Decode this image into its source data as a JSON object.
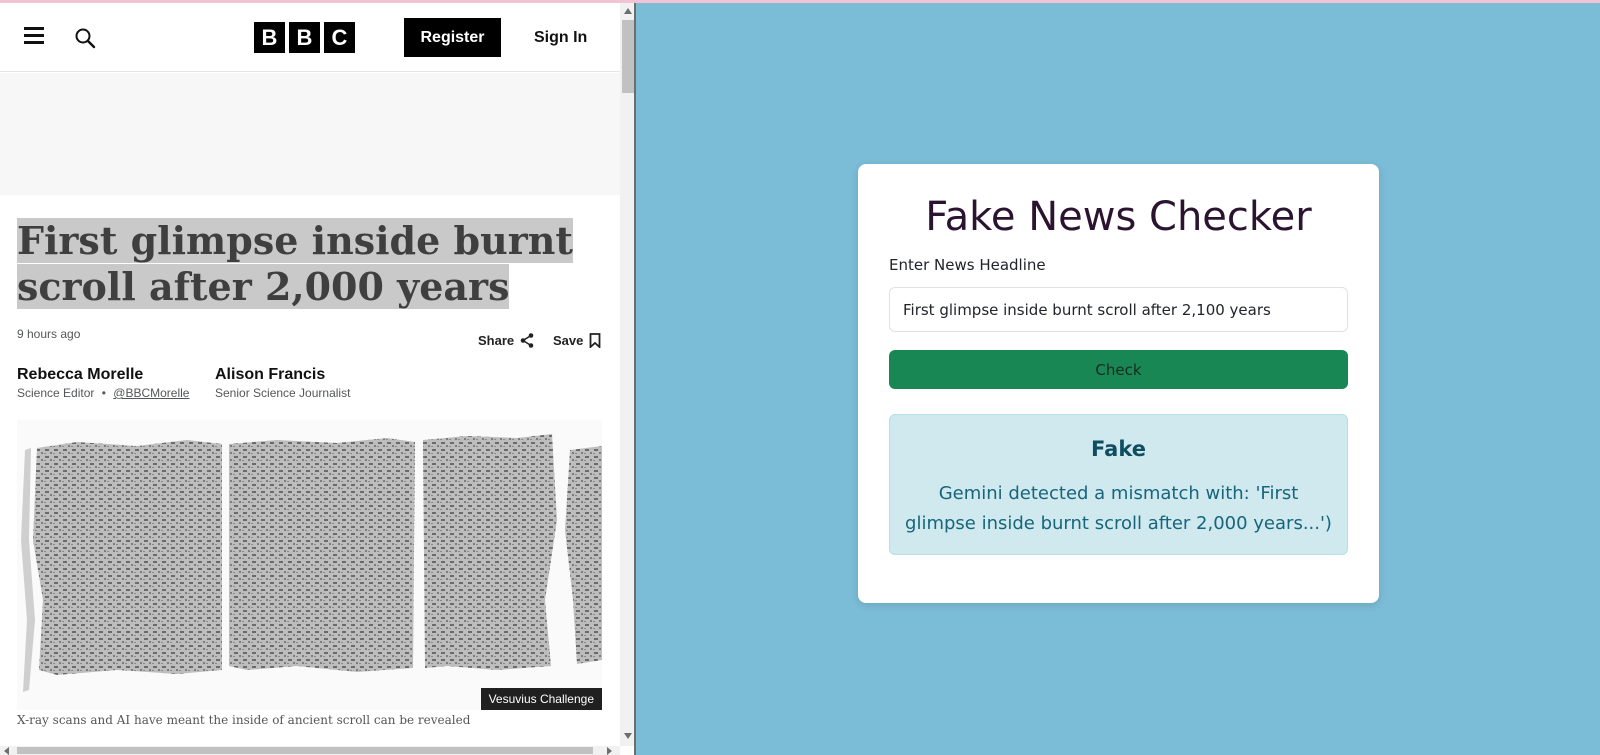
{
  "bbc": {
    "logo_letters": [
      "B",
      "B",
      "C"
    ],
    "register_label": "Register",
    "signin_label": "Sign In",
    "headline_line1": "First glimpse inside burnt",
    "headline_line2": "scroll after 2,000 years",
    "timestamp": "9 hours ago",
    "share_label": "Share",
    "save_label": "Save",
    "authors": [
      {
        "name": "Rebecca Morelle",
        "role": "Science Editor",
        "separator": "•",
        "handle": "@BBCMorelle"
      },
      {
        "name": "Alison Francis",
        "role": "Senior Science Journalist"
      }
    ],
    "photo_credit": "Vesuvius Challenge",
    "caption": "X-ray scans and AI have meant the inside of ancient scroll can be revealed"
  },
  "checker": {
    "title": "Fake News Checker",
    "field_label": "Enter News Headline",
    "input_value": "First glimpse inside burnt scroll after 2,100 years",
    "check_button": "Check",
    "result_title": "Fake",
    "result_text": "Gemini detected a mismatch with: 'First glimpse inside burnt scroll after 2,000 years...')"
  },
  "colors": {
    "page_background": "#7bbcd6",
    "check_button": "#198754",
    "result_background": "#cfe9ef",
    "title_color": "#2b1430"
  },
  "icons": [
    "menu-icon",
    "search-icon",
    "share-icon",
    "bookmark-icon"
  ]
}
